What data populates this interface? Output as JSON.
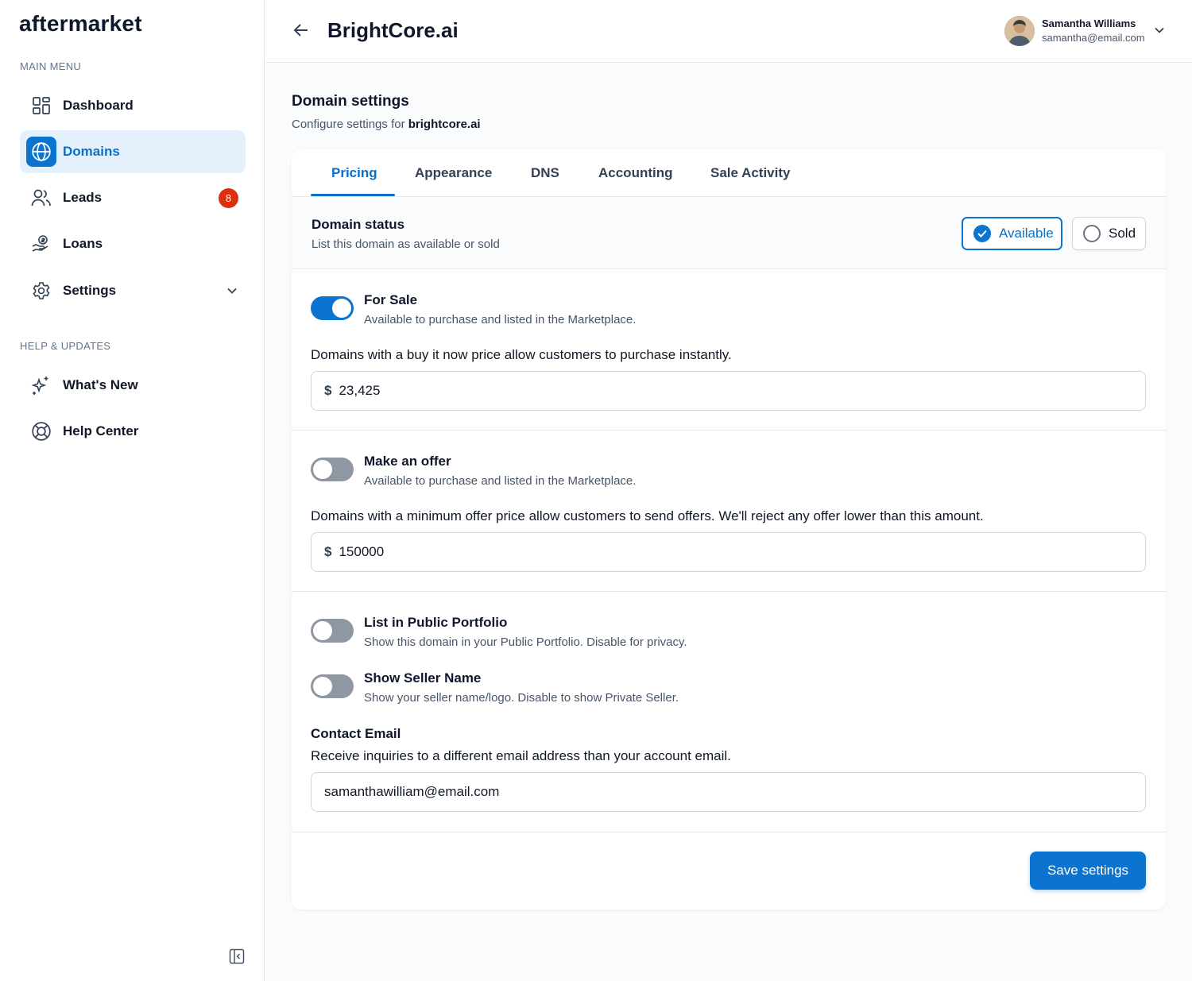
{
  "brand": {
    "logo_text": "aftermarket"
  },
  "sidebar": {
    "main_menu_label": "MAIN MENU",
    "help_label": "HELP & UPDATES",
    "items": [
      {
        "label": "Dashboard",
        "icon": "dashboard-icon"
      },
      {
        "label": "Domains",
        "icon": "globe-icon",
        "active": true
      },
      {
        "label": "Leads",
        "icon": "users-icon",
        "badge": "8"
      },
      {
        "label": "Loans",
        "icon": "loans-icon"
      },
      {
        "label": "Settings",
        "icon": "gear-icon"
      }
    ],
    "help_items": [
      {
        "label": "What's New",
        "icon": "sparkles-icon"
      },
      {
        "label": "Help Center",
        "icon": "lifebuoy-icon"
      }
    ]
  },
  "header": {
    "title": "BrightCore.ai",
    "user": {
      "name": "Samantha Williams",
      "email": "samantha@email.com"
    }
  },
  "settings": {
    "title": "Domain settings",
    "subtitle_prefix": "Configure settings for",
    "domain": "brightcore.ai",
    "tabs": [
      "Pricing",
      "Appearance",
      "DNS",
      "Accounting",
      "Sale Activity"
    ],
    "active_tab": "Pricing",
    "status": {
      "title": "Domain status",
      "description": "List this domain as available or sold",
      "options": [
        "Available",
        "Sold"
      ],
      "selected": "Available"
    },
    "for_sale": {
      "title": "For Sale",
      "description": "Available to purchase and listed in the Marketplace.",
      "enabled": true,
      "info": "Domains with a buy it now price allow customers to purchase instantly.",
      "currency": "$",
      "price": "23,425"
    },
    "make_offer": {
      "title": "Make an offer",
      "description": "Available to purchase and listed in the Marketplace.",
      "enabled": false,
      "info": "Domains with a minimum offer price allow customers to send offers. We'll reject any offer lower than this amount.",
      "currency": "$",
      "min_offer": "150000"
    },
    "public_portfolio": {
      "title": "List in Public Portfolio",
      "description": "Show this domain in your Public Portfolio. Disable for privacy.",
      "enabled": false
    },
    "seller_name": {
      "title": "Show Seller Name",
      "description": "Show your seller name/logo. Disable to show Private Seller.",
      "enabled": false
    },
    "contact_email": {
      "title": "Contact Email",
      "description": "Receive inquiries to a different email address than your account email.",
      "value": "samanthawilliam@email.com"
    },
    "save_label": "Save settings"
  },
  "colors": {
    "accent": "#0b73d0",
    "active_bg": "#e4f0fb",
    "badge": "#dc2f0b",
    "toggle_off": "#8f97a3"
  }
}
